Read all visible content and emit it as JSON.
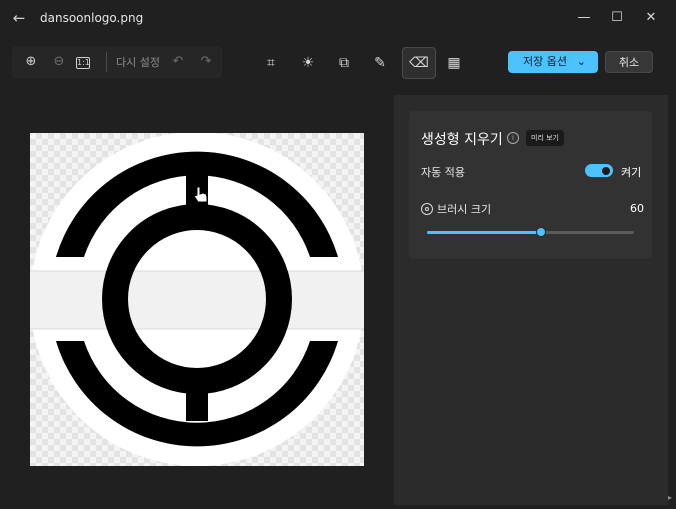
{
  "window": {
    "title": "dansoonlogo.png",
    "back_icon": "←",
    "minimize_icon": "—",
    "maximize_icon": "☐",
    "close_icon": "✕"
  },
  "toolbar": {
    "zoom_in_icon": "⊕",
    "zoom_out_icon": "⊖",
    "actual_size_icon": "1:1",
    "reset_label": "다시 설정",
    "undo_icon": "↶",
    "redo_icon": "↷",
    "crop_icon": "⌗",
    "adjust_icon": "☀",
    "filter_icon": "⧉",
    "markup_icon": "✎",
    "erase_icon": "⌫",
    "background_icon": "▦",
    "save_label": "저장 옵션",
    "save_chevron": "⌄",
    "cancel_label": "취소"
  },
  "panel": {
    "title": "생성형 지우기",
    "info_icon": "i",
    "preview_badge": "미리 보기",
    "auto_apply_label": "자동 적용",
    "auto_apply_state": "켜기",
    "brush_size_label": "브러시 크기",
    "brush_size_value": "60",
    "brush_size_fraction": 0.55
  },
  "colors": {
    "accent": "#4cc2ff",
    "background": "#202020",
    "panel": "#323232"
  }
}
